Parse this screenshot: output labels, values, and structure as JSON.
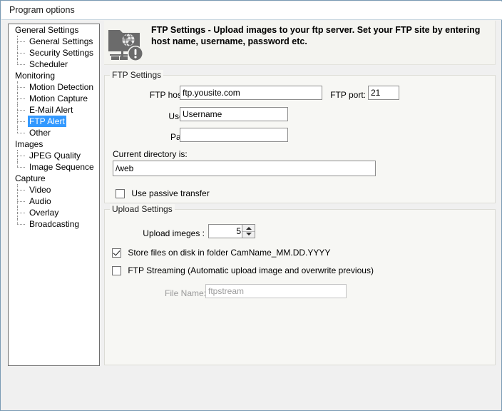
{
  "window": {
    "title": "Program options"
  },
  "sidebar": {
    "items": [
      {
        "label": "General Settings",
        "level": "root",
        "selected": false,
        "last": false
      },
      {
        "label": "General Settings",
        "level": "child",
        "selected": false,
        "last": false
      },
      {
        "label": "Security Settings",
        "level": "child",
        "selected": false,
        "last": false
      },
      {
        "label": "Scheduler",
        "level": "child",
        "selected": false,
        "last": true
      },
      {
        "label": "Monitoring",
        "level": "root",
        "selected": false,
        "last": false
      },
      {
        "label": "Motion Detection",
        "level": "child",
        "selected": false,
        "last": false
      },
      {
        "label": "Motion Capture",
        "level": "child",
        "selected": false,
        "last": false
      },
      {
        "label": "E-Mail Alert",
        "level": "child",
        "selected": false,
        "last": false
      },
      {
        "label": "FTP Alert",
        "level": "child",
        "selected": true,
        "last": false
      },
      {
        "label": "Other",
        "level": "child",
        "selected": false,
        "last": true
      },
      {
        "label": "Images",
        "level": "root",
        "selected": false,
        "last": false
      },
      {
        "label": "JPEG Quality",
        "level": "child",
        "selected": false,
        "last": false
      },
      {
        "label": "Image Sequence",
        "level": "child",
        "selected": false,
        "last": true
      },
      {
        "label": "Capture",
        "level": "root",
        "selected": false,
        "last": false
      },
      {
        "label": "Video",
        "level": "child",
        "selected": false,
        "last": false
      },
      {
        "label": "Audio",
        "level": "child",
        "selected": false,
        "last": false
      },
      {
        "label": "Overlay",
        "level": "child",
        "selected": false,
        "last": false
      },
      {
        "label": "Broadcasting",
        "level": "child",
        "selected": false,
        "last": true
      }
    ]
  },
  "header": {
    "icon": "ftp-folder-globe-alert-icon",
    "text": "FTP Settings - Upload images to your ftp server. Set your FTP site by entering host name, username, password etc."
  },
  "ftp_settings": {
    "group_title": "FTP Settings",
    "host_label": "FTP host name:",
    "host_value": "ftp.yousite.com",
    "port_label": "FTP port:",
    "port_value": "21",
    "username_label": "Username:",
    "username_value": "Username",
    "password_label": "Password:",
    "password_value": "",
    "directory_label": "Current directory is:",
    "directory_value": "/web",
    "passive_label": "Use passive transfer",
    "passive_checked": false
  },
  "upload_settings": {
    "group_title": "Upload Settings",
    "upload_images_label": "Upload imeges :",
    "upload_images_value": "5",
    "store_files_label": "Store files on disk in folder CamName_MM.DD.YYYY",
    "store_files_checked": true,
    "ftp_streaming_label": "FTP Streaming  (Automatic upload image and overwrite previous)",
    "ftp_streaming_checked": false,
    "file_name_label": "File Name:",
    "file_name_value": "ftpstream"
  },
  "colors": {
    "selection_blue": "#3399ff",
    "window_border": "#7a9bb5",
    "panel_bg": "#f7f7f4",
    "icon_gray": "#6b6b6b"
  }
}
